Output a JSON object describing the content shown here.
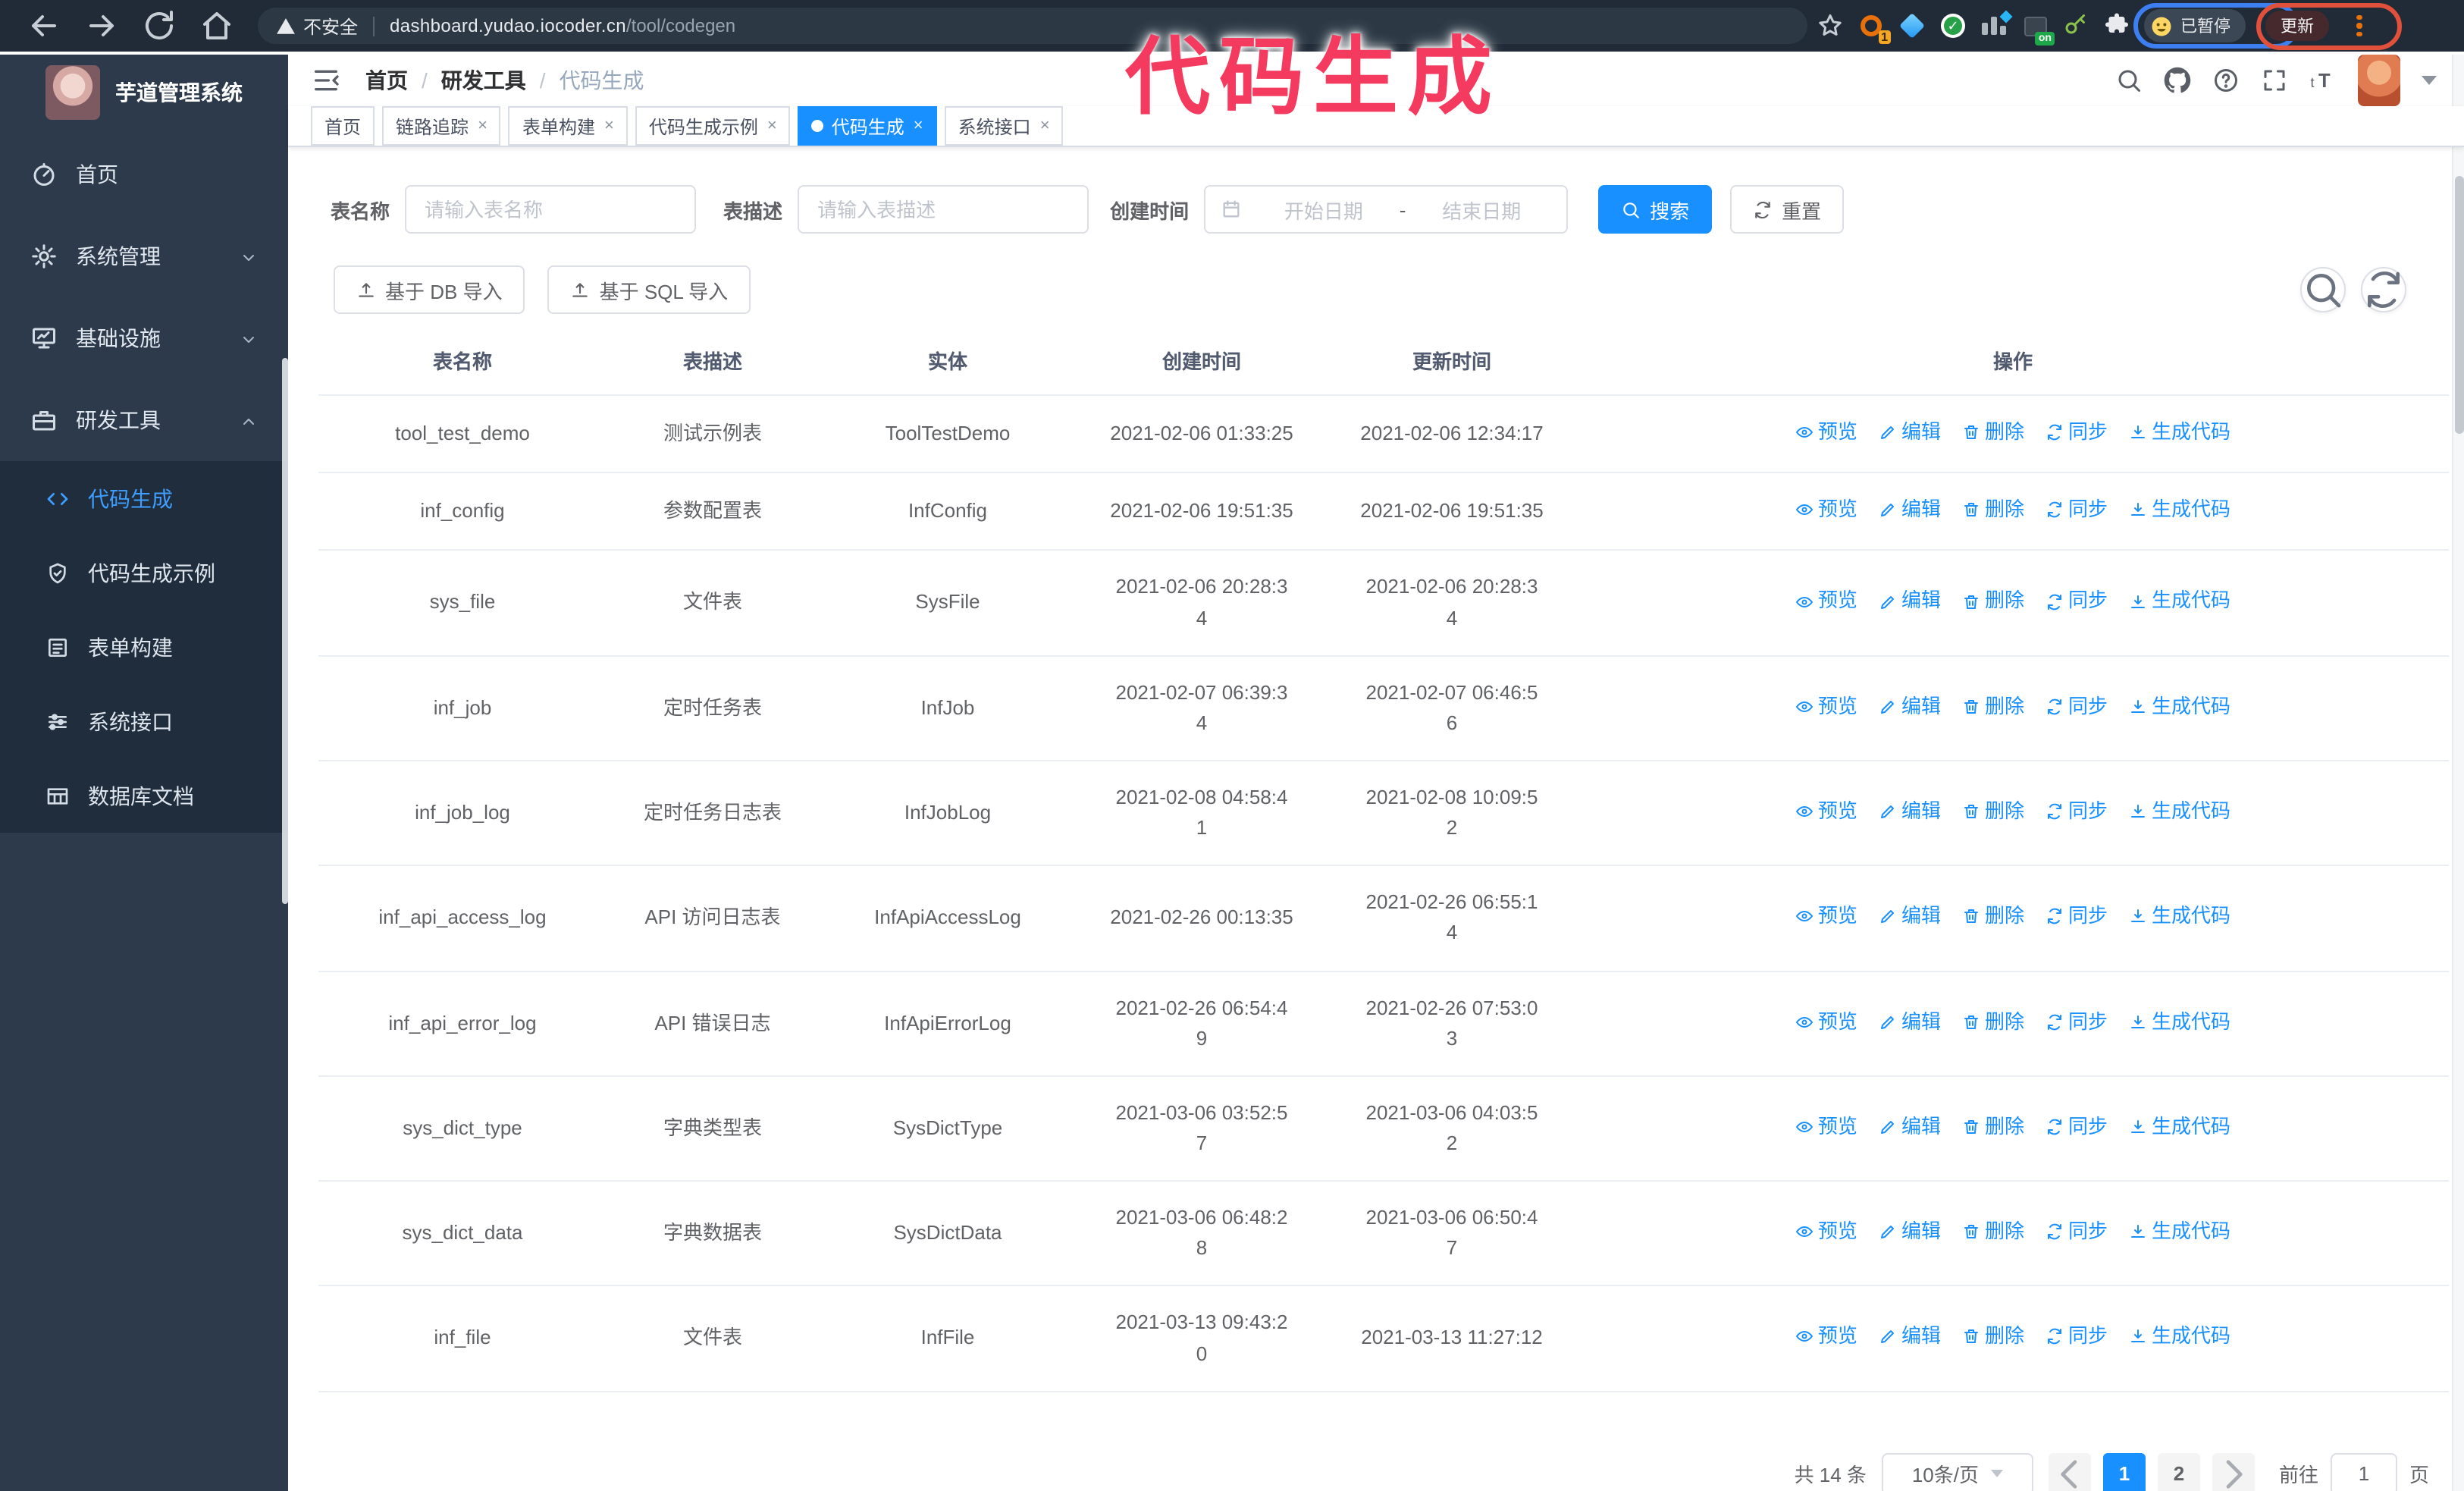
{
  "annotation": {
    "text": "代码生成",
    "color": "#f43b5f"
  },
  "browser": {
    "security_warning": "不安全",
    "url_host": "dashboard.yudao.iocoder.cn",
    "url_path": "/tool/codegen",
    "extension_badge_count": "1",
    "extension_on_badge": "on",
    "paused_badge": "已暂停",
    "update_button": "更新"
  },
  "sidebar": {
    "title": "芋道管理系统",
    "items": [
      {
        "name": "sidebar-item-home",
        "label": "首页",
        "icon": "dashboard-icon",
        "chevron": null
      },
      {
        "name": "sidebar-item-system",
        "label": "系统管理",
        "icon": "gear-icon",
        "chevron": "down"
      },
      {
        "name": "sidebar-item-infra",
        "label": "基础设施",
        "icon": "monitor-icon",
        "chevron": "down"
      },
      {
        "name": "sidebar-item-devtools",
        "label": "研发工具",
        "icon": "briefcase-icon",
        "chevron": "up"
      }
    ],
    "subitems": [
      {
        "name": "sidebar-subitem-codegen",
        "label": "代码生成",
        "icon": "code-icon",
        "active": true
      },
      {
        "name": "sidebar-subitem-codegen-example",
        "label": "代码生成示例",
        "icon": "shield-check-icon",
        "active": false
      },
      {
        "name": "sidebar-subitem-form-builder",
        "label": "表单构建",
        "icon": "form-icon",
        "active": false
      },
      {
        "name": "sidebar-subitem-system-api",
        "label": "系统接口",
        "icon": "sliders-icon",
        "active": false
      },
      {
        "name": "sidebar-subitem-db-doc",
        "label": "数据库文档",
        "icon": "db-table-icon",
        "active": false
      }
    ]
  },
  "header": {
    "breadcrumb": [
      "首页",
      "研发工具",
      "代码生成"
    ],
    "breadcrumb_separator": "/"
  },
  "tabs": [
    {
      "name": "tab-home",
      "label": "首页",
      "closable": false,
      "active": false
    },
    {
      "name": "tab-tracer",
      "label": "链路追踪",
      "closable": true,
      "active": false
    },
    {
      "name": "tab-form-builder",
      "label": "表单构建",
      "closable": true,
      "active": false
    },
    {
      "name": "tab-codegen-example",
      "label": "代码生成示例",
      "closable": true,
      "active": false
    },
    {
      "name": "tab-codegen",
      "label": "代码生成",
      "closable": true,
      "active": true
    },
    {
      "name": "tab-system-api",
      "label": "系统接口",
      "closable": true,
      "active": false
    }
  ],
  "filters": {
    "table_name_label": "表名称",
    "table_name_placeholder": "请输入表名称",
    "table_desc_label": "表描述",
    "table_desc_placeholder": "请输入表描述",
    "create_time_label": "创建时间",
    "date_start_placeholder": "开始日期",
    "date_separator": "-",
    "date_end_placeholder": "结束日期",
    "search_label": "搜索",
    "reset_label": "重置"
  },
  "toolbar": {
    "import_db_label": "基于 DB 导入",
    "import_sql_label": "基于 SQL 导入"
  },
  "table": {
    "columns": [
      "表名称",
      "表描述",
      "实体",
      "创建时间",
      "更新时间",
      "操作"
    ],
    "actions": [
      {
        "name": "action-preview",
        "label": "预览",
        "icon": "eye-icon"
      },
      {
        "name": "action-edit",
        "label": "编辑",
        "icon": "edit-icon"
      },
      {
        "name": "action-delete",
        "label": "删除",
        "icon": "delete-icon"
      },
      {
        "name": "action-sync",
        "label": "同步",
        "icon": "sync-icon"
      },
      {
        "name": "action-generate-code",
        "label": "生成代码",
        "icon": "download-icon"
      }
    ],
    "rows": [
      {
        "name": "tool_test_demo",
        "desc": "测试示例表",
        "entity": "ToolTestDemo",
        "create_time": "2021-02-06 01:33:25",
        "update_time": "2021-02-06 12:34:17"
      },
      {
        "name": "inf_config",
        "desc": "参数配置表",
        "entity": "InfConfig",
        "create_time": "2021-02-06 19:51:35",
        "update_time": "2021-02-06 19:51:35"
      },
      {
        "name": "sys_file",
        "desc": "文件表",
        "entity": "SysFile",
        "create_time": "2021-02-06 20:28:3\n4",
        "update_time": "2021-02-06 20:28:3\n4"
      },
      {
        "name": "inf_job",
        "desc": "定时任务表",
        "entity": "InfJob",
        "create_time": "2021-02-07 06:39:3\n4",
        "update_time": "2021-02-07 06:46:5\n6"
      },
      {
        "name": "inf_job_log",
        "desc": "定时任务日志表",
        "entity": "InfJobLog",
        "create_time": "2021-02-08 04:58:4\n1",
        "update_time": "2021-02-08 10:09:5\n2"
      },
      {
        "name": "inf_api_access_log",
        "desc": "API 访问日志表",
        "entity": "InfApiAccessLog",
        "create_time": "2021-02-26 00:13:35",
        "update_time": "2021-02-26 06:55:1\n4"
      },
      {
        "name": "inf_api_error_log",
        "desc": "API 错误日志",
        "entity": "InfApiErrorLog",
        "create_time": "2021-02-26 06:54:4\n9",
        "update_time": "2021-02-26 07:53:0\n3"
      },
      {
        "name": "sys_dict_type",
        "desc": "字典类型表",
        "entity": "SysDictType",
        "create_time": "2021-03-06 03:52:5\n7",
        "update_time": "2021-03-06 04:03:5\n2"
      },
      {
        "name": "sys_dict_data",
        "desc": "字典数据表",
        "entity": "SysDictData",
        "create_time": "2021-03-06 06:48:2\n8",
        "update_time": "2021-03-06 06:50:4\n7"
      },
      {
        "name": "inf_file",
        "desc": "文件表",
        "entity": "InfFile",
        "create_time": "2021-03-13 09:43:2\n0",
        "update_time": "2021-03-13 11:27:12"
      }
    ]
  },
  "pagination": {
    "total_label": "共 14 条",
    "page_size_label": "10条/页",
    "pages": [
      "1",
      "2"
    ],
    "active_page": "1",
    "goto_label": "前往",
    "goto_value": "1",
    "goto_suffix": "页"
  },
  "colors": {
    "primary": "#1890ff",
    "sidebar_bg": "#2d3a4b",
    "submenu_bg": "#1f2d3d",
    "sidebar_active_text": "#3f9eff",
    "annotation_pink": "#f43b5f",
    "browser_bar": "#202b37",
    "table_border": "#ebeef5"
  }
}
